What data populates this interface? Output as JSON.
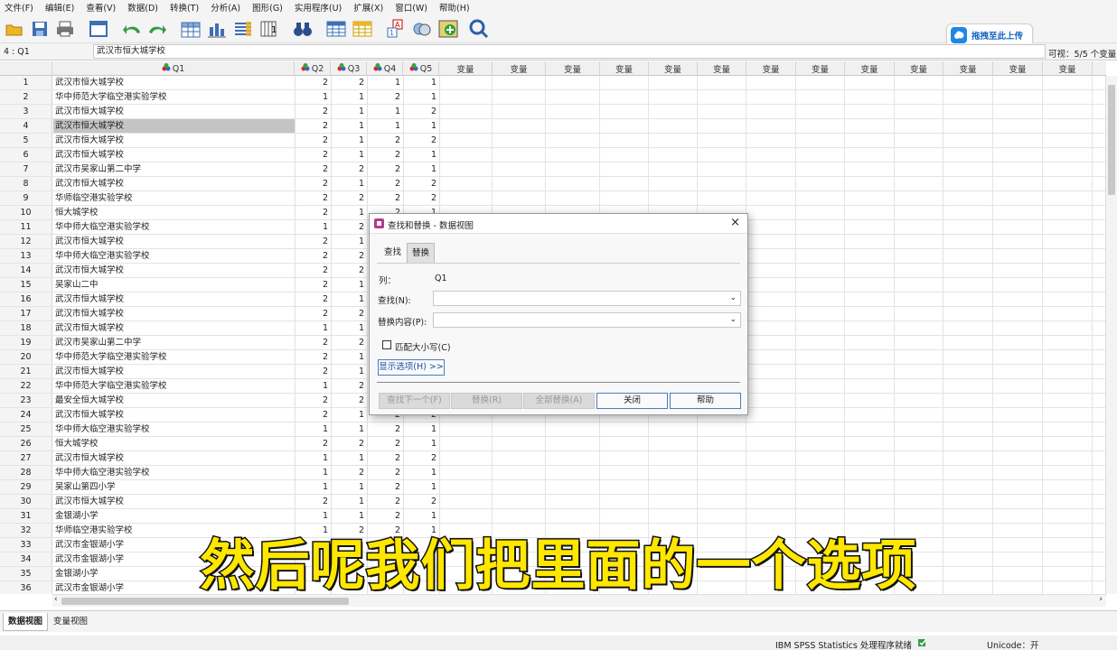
{
  "menu": [
    "文件(F)",
    "编辑(E)",
    "查看(V)",
    "数据(D)",
    "转换(T)",
    "分析(A)",
    "图形(G)",
    "实用程序(U)",
    "扩展(X)",
    "窗口(W)",
    "帮助(H)"
  ],
  "upload_label": "拖拽至此上传",
  "cell_ref": "4 : Q1",
  "cell_value": "武汉市恒大城学校",
  "visible_label": "可视：5/5 个变量",
  "columns": {
    "q1": "Q1",
    "q2": "Q2",
    "q3": "Q3",
    "q4": "Q4",
    "q5": "Q5",
    "var": "变量"
  },
  "rows": [
    [
      "1",
      "武汉市恒大城学校",
      "2",
      "2",
      "1",
      "1"
    ],
    [
      "2",
      "华中师范大学临空港实验学校",
      "1",
      "1",
      "2",
      "1"
    ],
    [
      "3",
      "武汉市恒大城学校",
      "2",
      "1",
      "1",
      "2"
    ],
    [
      "4",
      "武汉市恒大城学校",
      "2",
      "1",
      "1",
      "1"
    ],
    [
      "5",
      "武汉市恒大城学校",
      "2",
      "1",
      "2",
      "2"
    ],
    [
      "6",
      "武汉市恒大城学校",
      "2",
      "1",
      "2",
      "1"
    ],
    [
      "7",
      "武汉市吴家山第二中学",
      "2",
      "2",
      "2",
      "1"
    ],
    [
      "8",
      "武汉市恒大城学校",
      "2",
      "1",
      "2",
      "2"
    ],
    [
      "9",
      "华师临空港实验学校",
      "2",
      "2",
      "2",
      "2"
    ],
    [
      "10",
      "恒大城学校",
      "2",
      "1",
      "2",
      "1"
    ],
    [
      "11",
      "华中师大临空港实验学校",
      "1",
      "2",
      "",
      ""
    ],
    [
      "12",
      "武汉市恒大城学校",
      "2",
      "1",
      "",
      ""
    ],
    [
      "13",
      "华中师大临空港实验学校",
      "2",
      "2",
      "",
      ""
    ],
    [
      "14",
      "武汉市恒大城学校",
      "2",
      "2",
      "",
      ""
    ],
    [
      "15",
      "吴家山二中",
      "2",
      "1",
      "",
      ""
    ],
    [
      "16",
      "武汉市恒大城学校",
      "2",
      "1",
      "",
      ""
    ],
    [
      "17",
      "武汉市恒大城学校",
      "2",
      "2",
      "",
      ""
    ],
    [
      "18",
      "武汉市恒大城学校",
      "1",
      "1",
      "",
      ""
    ],
    [
      "19",
      "武汉市吴家山第二中学",
      "2",
      "2",
      "",
      ""
    ],
    [
      "20",
      "华中师范大学临空港实验学校",
      "2",
      "1",
      "",
      ""
    ],
    [
      "21",
      "武汉市恒大城学校",
      "2",
      "1",
      "",
      ""
    ],
    [
      "22",
      "华中师范大学临空港实验学校",
      "1",
      "2",
      "",
      ""
    ],
    [
      "23",
      "最安全恒大城学校",
      "2",
      "2",
      "",
      ""
    ],
    [
      "24",
      "武汉市恒大城学校",
      "2",
      "1",
      "2",
      "2"
    ],
    [
      "25",
      "华中师大临空港实验学校",
      "1",
      "1",
      "2",
      "1"
    ],
    [
      "26",
      "恒大城学校",
      "2",
      "2",
      "2",
      "1"
    ],
    [
      "27",
      "武汉市恒大城学校",
      "1",
      "1",
      "2",
      "2"
    ],
    [
      "28",
      "华中师大临空港实验学校",
      "1",
      "2",
      "2",
      "1"
    ],
    [
      "29",
      "吴家山第四小学",
      "1",
      "1",
      "2",
      "1"
    ],
    [
      "30",
      "武汉市恒大城学校",
      "2",
      "1",
      "2",
      "2"
    ],
    [
      "31",
      "金银湖小学",
      "1",
      "1",
      "2",
      "1"
    ],
    [
      "32",
      "华师临空港实验学校",
      "1",
      "2",
      "2",
      "1"
    ],
    [
      "33",
      "武汉市金银湖小学",
      "",
      "",
      "",
      ""
    ],
    [
      "34",
      "武汉市金银湖小学",
      "",
      "",
      "",
      ""
    ],
    [
      "35",
      "金银湖小学",
      "",
      "",
      "",
      ""
    ],
    [
      "36",
      "武汉市金银湖小学",
      "",
      "",
      "",
      ""
    ]
  ],
  "dialog": {
    "title": "查找和替换 - 数据视图",
    "close": "×",
    "tab_find": "查找",
    "tab_replace": "替换",
    "col_label": "列：",
    "col_value": "Q1",
    "find_label": "查找(N):",
    "replace_label": "替换内容(P):",
    "match_case": "匹配大小写(C)",
    "show_options": "显示选项(H) >>",
    "btn_find_next": "查找下一个(F)",
    "btn_replace": "替换(R)",
    "btn_replace_all": "全部替换(A)",
    "btn_close": "关闭",
    "btn_help": "帮助"
  },
  "tabs": {
    "data_view": "数据视图",
    "var_view": "变量视图"
  },
  "status": {
    "processor": "IBM SPSS Statistics 处理程序就绪",
    "unicode": "Unicode：开"
  },
  "caption": "然后呢我们把里面的一个选项"
}
